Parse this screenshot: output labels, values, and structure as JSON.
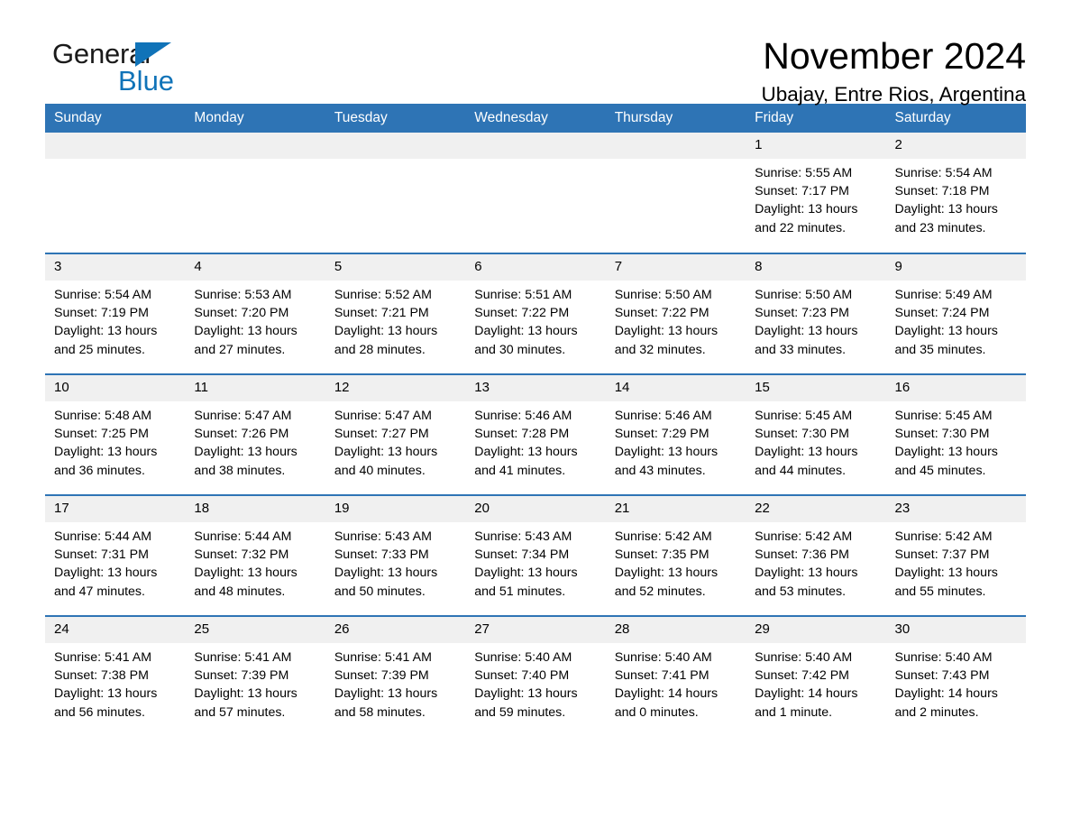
{
  "brand": {
    "name_part1": "General",
    "name_part2": "Blue",
    "accent_color": "#1073b8"
  },
  "header": {
    "title": "November 2024",
    "location": "Ubajay, Entre Rios, Argentina"
  },
  "calendar": {
    "header_color": "#2e74b5",
    "daynum_band_color": "#f0f0f0",
    "weekday_headers": [
      "Sunday",
      "Monday",
      "Tuesday",
      "Wednesday",
      "Thursday",
      "Friday",
      "Saturday"
    ],
    "weeks": [
      [
        {
          "day": "",
          "sunrise": "",
          "sunset": "",
          "daylight_line1": "",
          "daylight_line2": ""
        },
        {
          "day": "",
          "sunrise": "",
          "sunset": "",
          "daylight_line1": "",
          "daylight_line2": ""
        },
        {
          "day": "",
          "sunrise": "",
          "sunset": "",
          "daylight_line1": "",
          "daylight_line2": ""
        },
        {
          "day": "",
          "sunrise": "",
          "sunset": "",
          "daylight_line1": "",
          "daylight_line2": ""
        },
        {
          "day": "",
          "sunrise": "",
          "sunset": "",
          "daylight_line1": "",
          "daylight_line2": ""
        },
        {
          "day": "1",
          "sunrise": "Sunrise: 5:55 AM",
          "sunset": "Sunset: 7:17 PM",
          "daylight_line1": "Daylight: 13 hours",
          "daylight_line2": "and 22 minutes."
        },
        {
          "day": "2",
          "sunrise": "Sunrise: 5:54 AM",
          "sunset": "Sunset: 7:18 PM",
          "daylight_line1": "Daylight: 13 hours",
          "daylight_line2": "and 23 minutes."
        }
      ],
      [
        {
          "day": "3",
          "sunrise": "Sunrise: 5:54 AM",
          "sunset": "Sunset: 7:19 PM",
          "daylight_line1": "Daylight: 13 hours",
          "daylight_line2": "and 25 minutes."
        },
        {
          "day": "4",
          "sunrise": "Sunrise: 5:53 AM",
          "sunset": "Sunset: 7:20 PM",
          "daylight_line1": "Daylight: 13 hours",
          "daylight_line2": "and 27 minutes."
        },
        {
          "day": "5",
          "sunrise": "Sunrise: 5:52 AM",
          "sunset": "Sunset: 7:21 PM",
          "daylight_line1": "Daylight: 13 hours",
          "daylight_line2": "and 28 minutes."
        },
        {
          "day": "6",
          "sunrise": "Sunrise: 5:51 AM",
          "sunset": "Sunset: 7:22 PM",
          "daylight_line1": "Daylight: 13 hours",
          "daylight_line2": "and 30 minutes."
        },
        {
          "day": "7",
          "sunrise": "Sunrise: 5:50 AM",
          "sunset": "Sunset: 7:22 PM",
          "daylight_line1": "Daylight: 13 hours",
          "daylight_line2": "and 32 minutes."
        },
        {
          "day": "8",
          "sunrise": "Sunrise: 5:50 AM",
          "sunset": "Sunset: 7:23 PM",
          "daylight_line1": "Daylight: 13 hours",
          "daylight_line2": "and 33 minutes."
        },
        {
          "day": "9",
          "sunrise": "Sunrise: 5:49 AM",
          "sunset": "Sunset: 7:24 PM",
          "daylight_line1": "Daylight: 13 hours",
          "daylight_line2": "and 35 minutes."
        }
      ],
      [
        {
          "day": "10",
          "sunrise": "Sunrise: 5:48 AM",
          "sunset": "Sunset: 7:25 PM",
          "daylight_line1": "Daylight: 13 hours",
          "daylight_line2": "and 36 minutes."
        },
        {
          "day": "11",
          "sunrise": "Sunrise: 5:47 AM",
          "sunset": "Sunset: 7:26 PM",
          "daylight_line1": "Daylight: 13 hours",
          "daylight_line2": "and 38 minutes."
        },
        {
          "day": "12",
          "sunrise": "Sunrise: 5:47 AM",
          "sunset": "Sunset: 7:27 PM",
          "daylight_line1": "Daylight: 13 hours",
          "daylight_line2": "and 40 minutes."
        },
        {
          "day": "13",
          "sunrise": "Sunrise: 5:46 AM",
          "sunset": "Sunset: 7:28 PM",
          "daylight_line1": "Daylight: 13 hours",
          "daylight_line2": "and 41 minutes."
        },
        {
          "day": "14",
          "sunrise": "Sunrise: 5:46 AM",
          "sunset": "Sunset: 7:29 PM",
          "daylight_line1": "Daylight: 13 hours",
          "daylight_line2": "and 43 minutes."
        },
        {
          "day": "15",
          "sunrise": "Sunrise: 5:45 AM",
          "sunset": "Sunset: 7:30 PM",
          "daylight_line1": "Daylight: 13 hours",
          "daylight_line2": "and 44 minutes."
        },
        {
          "day": "16",
          "sunrise": "Sunrise: 5:45 AM",
          "sunset": "Sunset: 7:30 PM",
          "daylight_line1": "Daylight: 13 hours",
          "daylight_line2": "and 45 minutes."
        }
      ],
      [
        {
          "day": "17",
          "sunrise": "Sunrise: 5:44 AM",
          "sunset": "Sunset: 7:31 PM",
          "daylight_line1": "Daylight: 13 hours",
          "daylight_line2": "and 47 minutes."
        },
        {
          "day": "18",
          "sunrise": "Sunrise: 5:44 AM",
          "sunset": "Sunset: 7:32 PM",
          "daylight_line1": "Daylight: 13 hours",
          "daylight_line2": "and 48 minutes."
        },
        {
          "day": "19",
          "sunrise": "Sunrise: 5:43 AM",
          "sunset": "Sunset: 7:33 PM",
          "daylight_line1": "Daylight: 13 hours",
          "daylight_line2": "and 50 minutes."
        },
        {
          "day": "20",
          "sunrise": "Sunrise: 5:43 AM",
          "sunset": "Sunset: 7:34 PM",
          "daylight_line1": "Daylight: 13 hours",
          "daylight_line2": "and 51 minutes."
        },
        {
          "day": "21",
          "sunrise": "Sunrise: 5:42 AM",
          "sunset": "Sunset: 7:35 PM",
          "daylight_line1": "Daylight: 13 hours",
          "daylight_line2": "and 52 minutes."
        },
        {
          "day": "22",
          "sunrise": "Sunrise: 5:42 AM",
          "sunset": "Sunset: 7:36 PM",
          "daylight_line1": "Daylight: 13 hours",
          "daylight_line2": "and 53 minutes."
        },
        {
          "day": "23",
          "sunrise": "Sunrise: 5:42 AM",
          "sunset": "Sunset: 7:37 PM",
          "daylight_line1": "Daylight: 13 hours",
          "daylight_line2": "and 55 minutes."
        }
      ],
      [
        {
          "day": "24",
          "sunrise": "Sunrise: 5:41 AM",
          "sunset": "Sunset: 7:38 PM",
          "daylight_line1": "Daylight: 13 hours",
          "daylight_line2": "and 56 minutes."
        },
        {
          "day": "25",
          "sunrise": "Sunrise: 5:41 AM",
          "sunset": "Sunset: 7:39 PM",
          "daylight_line1": "Daylight: 13 hours",
          "daylight_line2": "and 57 minutes."
        },
        {
          "day": "26",
          "sunrise": "Sunrise: 5:41 AM",
          "sunset": "Sunset: 7:39 PM",
          "daylight_line1": "Daylight: 13 hours",
          "daylight_line2": "and 58 minutes."
        },
        {
          "day": "27",
          "sunrise": "Sunrise: 5:40 AM",
          "sunset": "Sunset: 7:40 PM",
          "daylight_line1": "Daylight: 13 hours",
          "daylight_line2": "and 59 minutes."
        },
        {
          "day": "28",
          "sunrise": "Sunrise: 5:40 AM",
          "sunset": "Sunset: 7:41 PM",
          "daylight_line1": "Daylight: 14 hours",
          "daylight_line2": "and 0 minutes."
        },
        {
          "day": "29",
          "sunrise": "Sunrise: 5:40 AM",
          "sunset": "Sunset: 7:42 PM",
          "daylight_line1": "Daylight: 14 hours",
          "daylight_line2": "and 1 minute."
        },
        {
          "day": "30",
          "sunrise": "Sunrise: 5:40 AM",
          "sunset": "Sunset: 7:43 PM",
          "daylight_line1": "Daylight: 14 hours",
          "daylight_line2": "and 2 minutes."
        }
      ]
    ]
  }
}
